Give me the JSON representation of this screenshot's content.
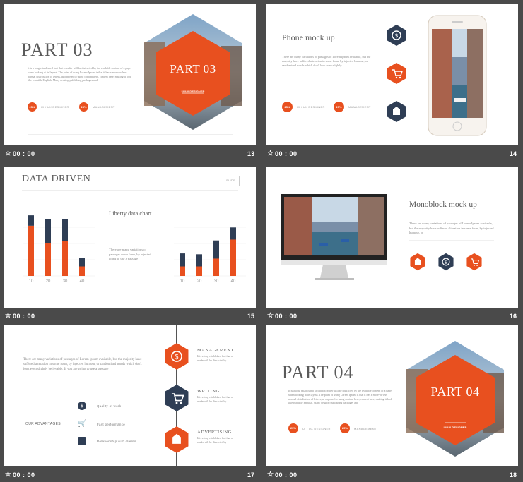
{
  "colors": {
    "accent": "#e8501f",
    "navy": "#2f3e55",
    "grey": "#5a5a5a"
  },
  "slides": [
    {
      "time": "00 : 00",
      "number": "13",
      "title": "PART 03",
      "hex_title": "PART 03",
      "hex_sub": "UI/UX DESIGNER",
      "body": "It is a long established fact that a reader will be distracted by the readable content of a page when looking at its layout. The point of using Lorem Ipsum is that it has a more-or-less normal distribution of letters, as opposed to using content here, content here, making it look like readable English. Many desktop publishing packages and",
      "stat1_pct": "25%",
      "stat1_label": "UI / UX DESIGNER",
      "stat2_pct": "25%",
      "stat2_label": "MANAGEMENT"
    },
    {
      "time": "00 : 00",
      "number": "14",
      "title": "Phone mock up",
      "body": "There are many variations of passages of Lorem Ipsum available, but the majority have suffered alteration in some form, by injected humour, or randomised words which don't look even slightly",
      "stat1_pct": "25%",
      "stat1_label": "UI / UX DESIGNER",
      "stat2_pct": "25%",
      "stat2_label": "MANAGEMENT",
      "icons": [
        "dollar-icon",
        "cart-icon",
        "tag-icon"
      ]
    },
    {
      "time": "00 : 00",
      "number": "15",
      "title": "DATA DRIVEN",
      "slide_label": "SLIDE",
      "subtitle": "Liberty data chart",
      "body": "There are many variations of passages some form, by injected going to use a passage",
      "chart_left": {
        "type": "bar",
        "categories": [
          "10",
          "20",
          "30",
          "40"
        ],
        "series": [
          {
            "values": [
              58,
              38,
              40,
              11
            ]
          },
          {
            "values": [
              12,
              28,
              26,
              10
            ]
          }
        ],
        "ylim": [
          0,
          75
        ]
      },
      "chart_right": {
        "type": "bar",
        "categories": [
          "10",
          "20",
          "30",
          "40"
        ],
        "series": [
          {
            "values": [
              11,
              11,
              20,
              42
            ]
          },
          {
            "values": [
              15,
              14,
              21,
              14
            ]
          }
        ],
        "ylim": [
          0,
          75
        ]
      }
    },
    {
      "time": "00 : 00",
      "number": "16",
      "title": "Monoblock mock up",
      "body": "There are many variations of passages of Lorem Ipsum available, but the majority have suffered alteration in some form, by injected humour, or",
      "icons": [
        "tag-icon",
        "dollar-icon",
        "cart-icon"
      ]
    },
    {
      "time": "00 : 00",
      "number": "17",
      "body": "There are many variations of passages of Lorem Ipsum available, but the majority have suffered alteration in some form, by injected humour, or randomised words which don't look even slightly believable. If you are going to use a passage",
      "advantages_label": "OUR ADVANTAGES",
      "features": [
        "Quality of work",
        "Fast performance",
        "Relationship with clients"
      ],
      "timeline": [
        {
          "label": "MANAGEMENT",
          "text": "It is a long established fact that a reader will be distracted by"
        },
        {
          "label": "WRITING",
          "text": "It is a long established fact that a reader will be distracted by"
        },
        {
          "label": "ADVERTISING",
          "text": "It is a long established fact that a reader will be distracted by"
        }
      ]
    },
    {
      "time": "00 : 00",
      "number": "18",
      "title": "PART 04",
      "hex_title": "PART 04",
      "hex_sub": "UI/UX DESIGNER",
      "body": "It is a long established fact that a reader will be distracted by the readable content of a page when looking at its layout. The point of using Lorem Ipsum is that it has a more-or-less normal distribution of letters, as opposed to using content here, content here, making it look like readable English. Many desktop publishing packages and",
      "stat1_pct": "25%",
      "stat1_label": "UI / UX DESIGNER",
      "stat2_pct": "25%",
      "stat2_label": "MANAGEMENT"
    }
  ]
}
